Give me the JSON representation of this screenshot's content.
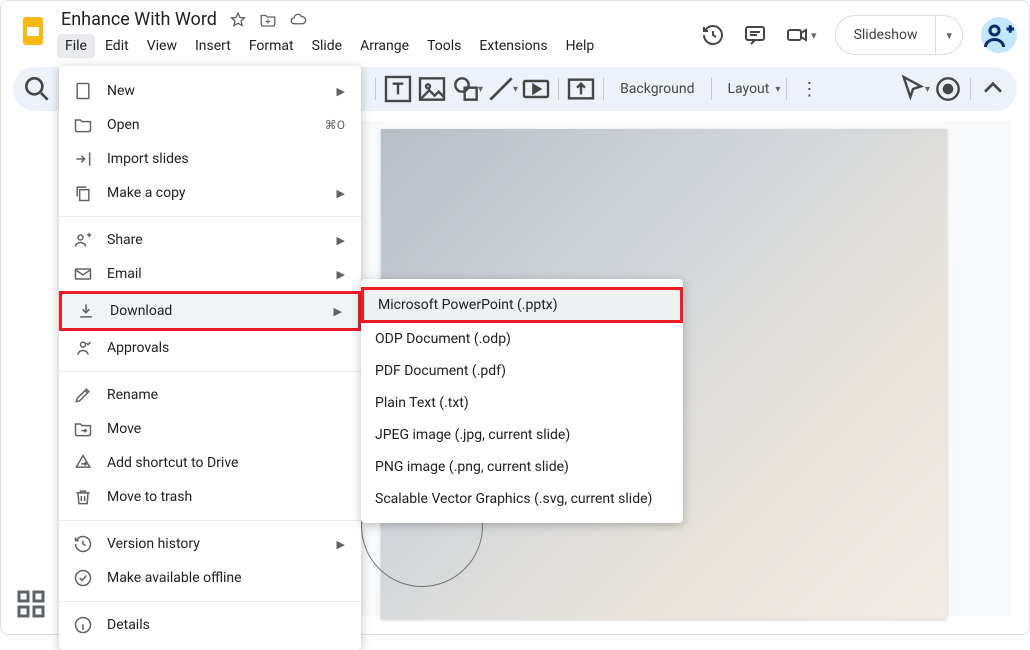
{
  "doc": {
    "title": "Enhance With Word"
  },
  "menubar": [
    "File",
    "Edit",
    "View",
    "Insert",
    "Format",
    "Slide",
    "Arrange",
    "Tools",
    "Extensions",
    "Help"
  ],
  "header_buttons": {
    "slideshow": "Slideshow"
  },
  "toolbar": {
    "background": "Background",
    "layout": "Layout"
  },
  "file_menu": {
    "new": "New",
    "open": "Open",
    "open_shortcut": "⌘O",
    "import_slides": "Import slides",
    "make_copy": "Make a copy",
    "share": "Share",
    "email": "Email",
    "download": "Download",
    "approvals": "Approvals",
    "rename": "Rename",
    "move": "Move",
    "add_shortcut": "Add shortcut to Drive",
    "move_trash": "Move to trash",
    "version_history": "Version history",
    "available_offline": "Make available offline",
    "details": "Details"
  },
  "download_menu": {
    "pptx": "Microsoft PowerPoint (.pptx)",
    "odp": "ODP Document (.odp)",
    "pdf": "PDF Document (.pdf)",
    "txt": "Plain Text (.txt)",
    "jpg": "JPEG image (.jpg, current slide)",
    "png": "PNG image (.png, current slide)",
    "svg": "Scalable Vector Graphics (.svg, current slide)"
  }
}
